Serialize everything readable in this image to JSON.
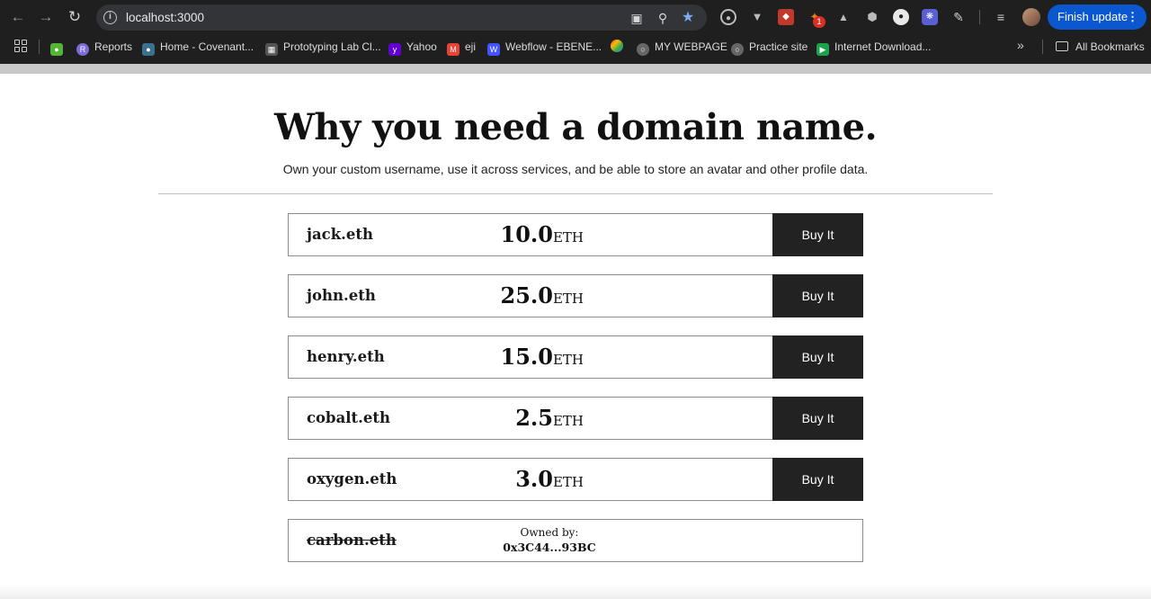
{
  "browser": {
    "url": "localhost:3000",
    "finish_update_label": "Finish update",
    "extension_badge": "1",
    "bookmarks": [
      {
        "label": "",
        "icon": "green-square-icon"
      },
      {
        "label": "Reports",
        "icon": "reports-icon"
      },
      {
        "label": "Home - Covenant...",
        "icon": "covenant-icon"
      },
      {
        "label": "Prototyping Lab Cl...",
        "icon": "grid-icon"
      },
      {
        "label": "Yahoo",
        "icon": "yahoo-icon"
      },
      {
        "label": "eji",
        "icon": "gmail-icon"
      },
      {
        "label": "Webflow - EBENE...",
        "icon": "webflow-icon"
      },
      {
        "label": "",
        "icon": "pinwheel-icon"
      },
      {
        "label": "MY WEBPAGE",
        "icon": "globe-icon"
      },
      {
        "label": "Practice site",
        "icon": "globe-icon"
      },
      {
        "label": "Internet Download...",
        "icon": "idm-icon"
      }
    ],
    "all_bookmarks_label": "All Bookmarks"
  },
  "page": {
    "headline": "Why you need a domain name.",
    "subline": "Own your custom username, use it across services, and be able to store an avatar and other profile data."
  },
  "domains": [
    {
      "name": "jack.eth",
      "amount": "10.0",
      "unit": "ETH",
      "button": "Buy It"
    },
    {
      "name": "john.eth",
      "amount": "25.0",
      "unit": "ETH",
      "button": "Buy It"
    },
    {
      "name": "henry.eth",
      "amount": "15.0",
      "unit": "ETH",
      "button": "Buy It"
    },
    {
      "name": "cobalt.eth",
      "amount": "2.5",
      "unit": "ETH",
      "button": "Buy It"
    },
    {
      "name": "oxygen.eth",
      "amount": "3.0",
      "unit": "ETH",
      "button": "Buy It"
    }
  ],
  "owned_domain": {
    "name": "carbon.eth",
    "owned_label": "Owned by:",
    "owner": "0x3C44...93BC"
  },
  "colors": {
    "chrome_bg": "#1f1f1f",
    "accent_blue": "#0b57d0",
    "button_dark": "#222222"
  }
}
